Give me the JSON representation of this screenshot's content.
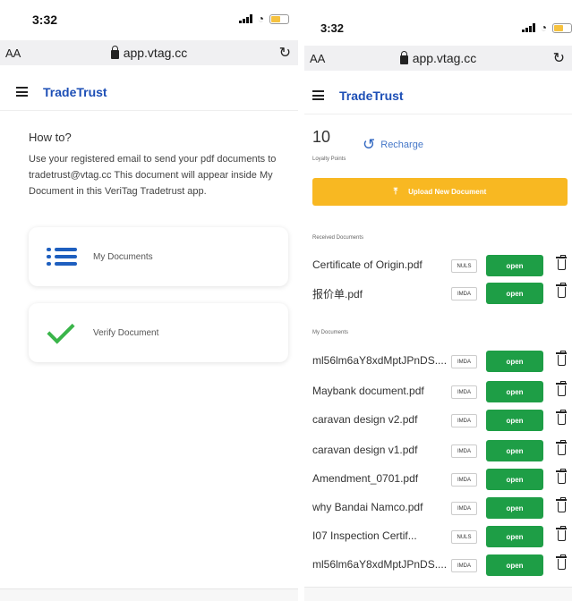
{
  "left": {
    "status": {
      "time": "3:32"
    },
    "urlbar": {
      "aa": "AA",
      "url": "app.vtag.cc"
    },
    "appbar": {
      "brand": "TradeTrust"
    },
    "howto": {
      "title": "How to?",
      "description": "Use your registered email to send your pdf documents to tradetrust@vtag.cc This document will appear inside My Document in this VeriTag Tradetrust app."
    },
    "cards": [
      {
        "label": "My Documents",
        "icon": "list-icon"
      },
      {
        "label": "Verify Document",
        "icon": "check-icon"
      }
    ]
  },
  "right": {
    "status": {
      "time": "3:32"
    },
    "urlbar": {
      "aa": "AA",
      "url": "app.vtag.cc"
    },
    "appbar": {
      "brand": "TradeTrust"
    },
    "points": {
      "value": "10",
      "label": "Loyalty Points"
    },
    "recharge_label": "Recharge",
    "upload_label": "Upload New Document",
    "received_label": "Received Documents",
    "received": [
      {
        "name": "Certificate of Origin.pdf",
        "tag": "NULS",
        "action": "open"
      },
      {
        "name": "报价单.pdf",
        "tag": "IMDA",
        "action": "open"
      }
    ],
    "mydocs_label": "My Documents",
    "mydocs": [
      {
        "name": "ml56lm6aY8xdMptJPnDS....",
        "tag": "IMDA",
        "action": "open"
      },
      {
        "name": "Maybank document.pdf",
        "tag": "IMDA",
        "action": "open"
      },
      {
        "name": "caravan design v2.pdf",
        "tag": "IMDA",
        "action": "open"
      },
      {
        "name": "caravan design v1.pdf",
        "tag": "IMDA",
        "action": "open"
      },
      {
        "name": "Amendment_0701.pdf",
        "tag": "IMDA",
        "action": "open"
      },
      {
        "name": "why Bandai Namco.pdf",
        "tag": "IMDA",
        "action": "open"
      },
      {
        "name": "I07 Inspection Certif...",
        "tag": "NULS",
        "action": "open"
      },
      {
        "name": "ml56lm6aY8xdMptJPnDS....",
        "tag": "IMDA",
        "action": "open"
      }
    ]
  },
  "colors": {
    "brand": "#1d4fb6",
    "upload": "#f8b822",
    "open": "#1e9e46",
    "check": "#3ab54a"
  }
}
